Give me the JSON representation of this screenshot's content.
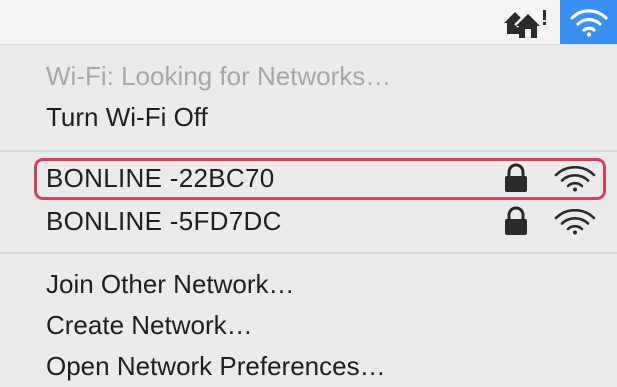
{
  "menubar": {
    "home_icon": "home-network-alert-icon",
    "wifi_icon": "wifi-icon",
    "wifi_active_color": "#3a8ff2"
  },
  "menu": {
    "status": "Wi-Fi: Looking for Networks…",
    "toggle": "Turn Wi-Fi Off",
    "networks": [
      {
        "name": "BONLINE -22BC70",
        "secured": true,
        "highlighted": true
      },
      {
        "name": "BONLINE -5FD7DC",
        "secured": true,
        "highlighted": false
      }
    ],
    "join_other": "Join Other Network…",
    "create": "Create Network…",
    "preferences": "Open Network Preferences…"
  },
  "colors": {
    "highlight": "#d8405c",
    "text": "#1e1e1e",
    "disabled": "#a7a7a7"
  }
}
